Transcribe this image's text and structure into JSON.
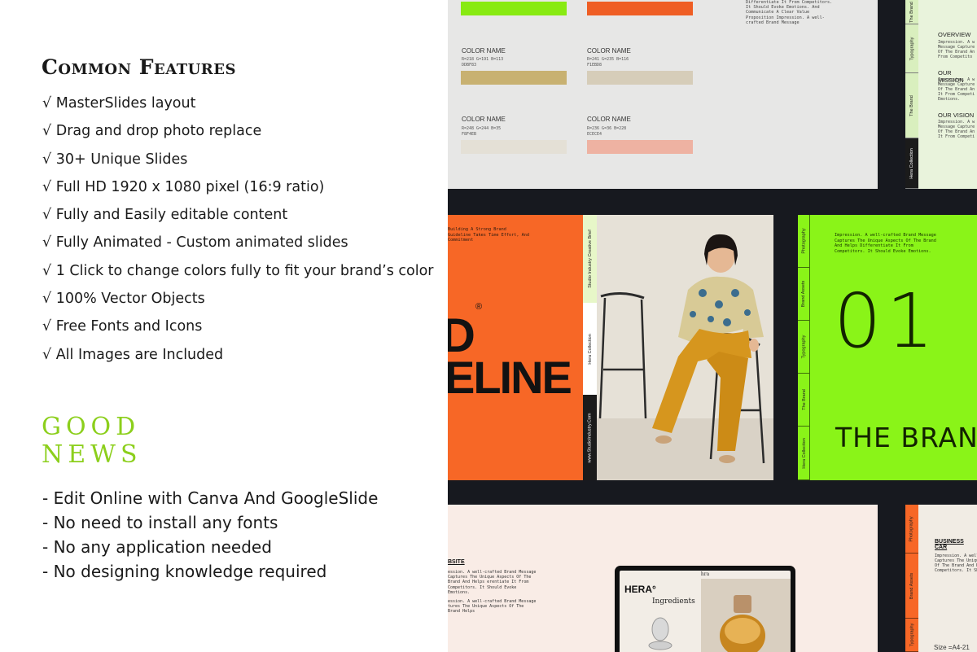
{
  "left": {
    "section_title": "Common Features",
    "features": [
      "√ MasterSlides layout",
      "√ Drag and drop photo replace",
      "√ 30+ Unique Slides",
      "√ Full HD 1920 x 1080 pixel (16:9 ratio)",
      "√ Fully and Easily editable content",
      "√ Fully Animated - Custom animated slides",
      "√ 1 Click to change colors fully to fit your brand’s color",
      "√ 100% Vector Objects",
      "√ Free Fonts and Icons",
      "√ All Images are Included"
    ],
    "good_news_line1": "GOOD",
    "good_news_line2": "NEWS",
    "news": [
      "- Edit Online with Canva And GoogleSlide",
      "- No need to install any fonts",
      "- No any application needed",
      "- No designing knowledge required"
    ]
  },
  "palette_slide": {
    "colors": [
      {
        "name": "COLOR NAME",
        "rgb": "R=218 G=191 B=113",
        "hex": "DDBF83",
        "swatch": "#c8b171"
      },
      {
        "name": "COLOR NAME",
        "rgb": "R=241 G=235 B=116",
        "hex": "F1EBD8",
        "swatch": "#d6cdb9"
      },
      {
        "name": "COLOR NAME",
        "rgb": "R=248 G=244 B=35",
        "hex": "F8F4EB",
        "swatch": "#e4e0d6"
      },
      {
        "name": "COLOR NAME",
        "rgb": "R=236 G=36 B=228",
        "hex": "ECECE4",
        "swatch": "#eeb2a2"
      }
    ],
    "top_swatches": [
      "#88ea12",
      "#ef5e24"
    ],
    "side_text": "Differentiate It From Competitors. It Should Evoke Emotions. And Communicate A Clear Value Proposition Impression. A well-crafted Brand Message"
  },
  "top_right_slide": {
    "tabs": [
      "The Brand",
      "Typography",
      "The Brand",
      "Hera Collection"
    ],
    "sections": [
      {
        "heading": "OVERVIEW",
        "body": "Impression. A w\nMessage Capture\nOf The Brand An\nFrom Competito"
      },
      {
        "heading": "OUR MISSION",
        "body": "Impression. A w\nMessage Capture\nOf The Brand An\nIt From Competi\nEmotions."
      },
      {
        "heading": "OUR VISION",
        "body": "Impression. A w\nMessage Capture\nOf The Brand An\nIt From Competi"
      }
    ]
  },
  "orange_slide": {
    "intro": "Building A Strong Brand Guideline Takes Time Effort, And Commitment",
    "big_line1": "D",
    "big_line2": "ELINE",
    "registered": "®",
    "strip_labels": [
      "Studio Industry Creative Brief",
      "Hera Collection",
      "www.StudioIndustry.Com"
    ]
  },
  "green_slide": {
    "tabs": [
      "Photography",
      "Brand Assets",
      "Typography",
      "The Brand",
      "Hera Collection"
    ],
    "text": "Impression. A well-crafted Brand Message Captures The Unique Aspects Of The Brand And Helps Differentiate It From Competitors. It Should Evoke Emotions.",
    "number": "01",
    "title": "THE BRAND"
  },
  "pink_slide": {
    "heading": "BSITE",
    "body1": "ession. A well-crafted Brand Message Captures The Unique Aspects Of The Brand And Helps erentiate It From Competitors. It Should Evoke Emotions.",
    "body2": "ession. A well-crafted Brand Message tures The Unique Aspects Of The Brand Helps",
    "laptop": {
      "screen_title": "hra",
      "brand": "HERA°",
      "heading": "Ingredients"
    }
  },
  "bottom_right_slide": {
    "tabs": [
      "Photography",
      "Brand Assets",
      "Typography"
    ],
    "heading": "BUSINESS CAR",
    "body": "Impression. A well-c\nCaptures The Unique\nOf The Brand And He\nCompetitors. It Shou",
    "size": "Size =A4-21"
  }
}
